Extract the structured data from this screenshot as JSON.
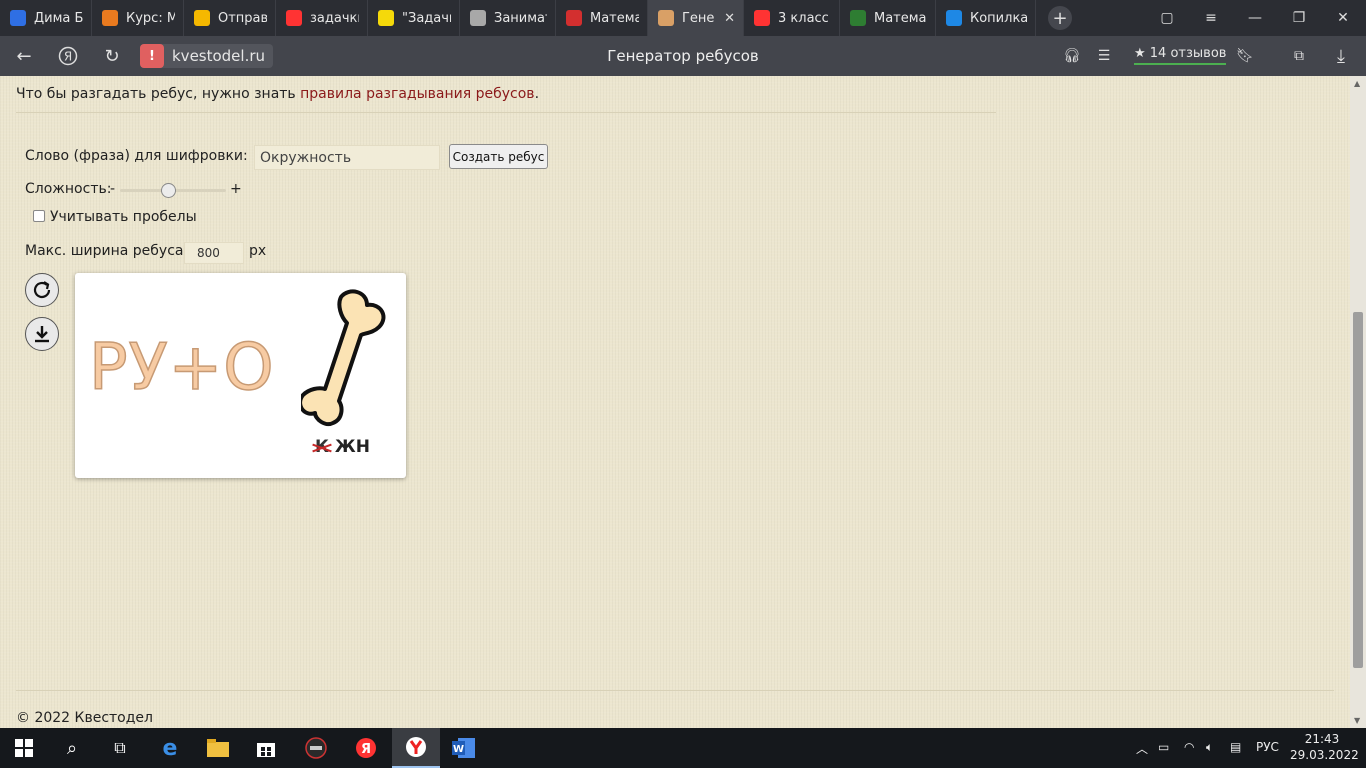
{
  "browser": {
    "tabs": [
      {
        "label": "Дима Би",
        "icon": "blue-pause-icon",
        "color": "#2f6fe4"
      },
      {
        "label": "Курс: М",
        "icon": "orange-m-icon",
        "color": "#e97a1f"
      },
      {
        "label": "Отправ",
        "icon": "mail-icon",
        "color": "#f5b800"
      },
      {
        "label": "задачки",
        "icon": "yandex-icon",
        "color": "#f33"
      },
      {
        "label": "\"Задачи",
        "icon": "yellow-i-icon",
        "color": "#f5d90a"
      },
      {
        "label": "Заниматель",
        "icon": "puzzle-icon",
        "color": "#a8a8a8"
      },
      {
        "label": "Матема",
        "icon": "red-p-icon",
        "color": "#d32f2f"
      },
      {
        "label": "Генер",
        "icon": "rebus-icon",
        "color": "#d9a066",
        "active": true
      },
      {
        "label": "3 класс",
        "icon": "yandex-icon",
        "color": "#f33"
      },
      {
        "label": "Матема",
        "icon": "check-icon",
        "color": "#2e7d32"
      },
      {
        "label": "Копилка",
        "icon": "book-icon",
        "color": "#1e88e5"
      }
    ],
    "domain": "kvestodel.ru",
    "page_title": "Генератор ребусов",
    "reviews": "★ 14 отзывов"
  },
  "page": {
    "intro_text": "Что бы разгадать ребус, нужно знать",
    "intro_link": "правила разгадывания ребусов",
    "intro_end": ".",
    "phrase_label": "Слово (фраза) для шифровки:",
    "phrase_value": "Окружность",
    "create_button": "Создать ребус",
    "difficulty_label": "Сложность:",
    "difficulty_minus": "-",
    "difficulty_plus": "+",
    "difficulty_level": 0.45,
    "spaces_label": "Учитывать пробелы",
    "width_label": "Макс. ширина ребуса:",
    "width_value": "800",
    "width_unit": "px",
    "rebus": {
      "text": "РУ+О",
      "struck_letter": "К",
      "sub_text": "ЖН"
    },
    "copyright": "© 2022 Квестодел"
  },
  "taskbar": {
    "language": "РУС",
    "time": "21:43",
    "date": "29.03.2022"
  }
}
